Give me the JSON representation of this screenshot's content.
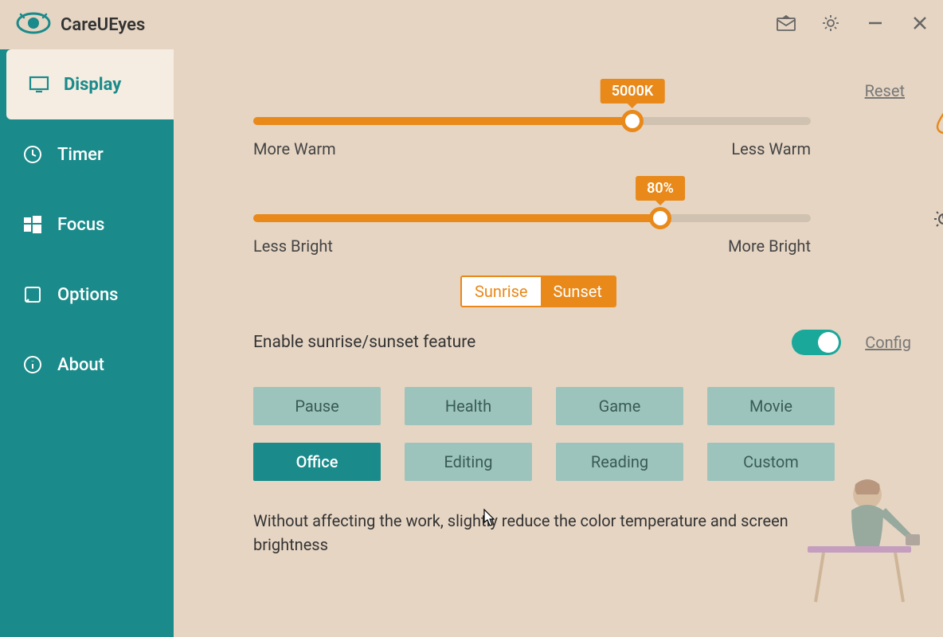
{
  "app": {
    "name": "CareUEyes"
  },
  "sidebar": {
    "items": [
      {
        "label": "Display",
        "active": true
      },
      {
        "label": "Timer"
      },
      {
        "label": "Focus"
      },
      {
        "label": "Options"
      },
      {
        "label": "About"
      }
    ]
  },
  "display": {
    "reset": "Reset",
    "temp": {
      "value": "5000K",
      "percent": 68,
      "left_label": "More Warm",
      "right_label": "Less Warm"
    },
    "brightness": {
      "value": "80%",
      "percent": 73,
      "left_label": "Less Bright",
      "right_label": "More Bright"
    },
    "sun": {
      "sunrise": "Sunrise",
      "sunset": "Sunset",
      "selected": "sunset"
    },
    "feature_label": "Enable sunrise/sunset feature",
    "feature_enabled": true,
    "config": "Config",
    "modes": [
      {
        "label": "Pause"
      },
      {
        "label": "Health"
      },
      {
        "label": "Game"
      },
      {
        "label": "Movie"
      },
      {
        "label": "Office",
        "active": true
      },
      {
        "label": "Editing"
      },
      {
        "label": "Reading"
      },
      {
        "label": "Custom"
      }
    ],
    "description": "Without affecting the work, slightly reduce the color temperature and screen brightness"
  }
}
